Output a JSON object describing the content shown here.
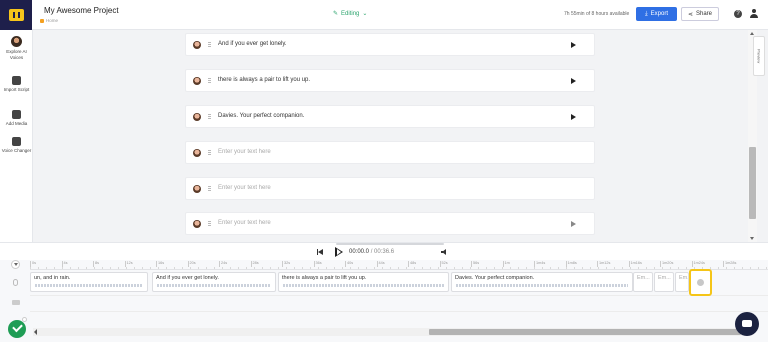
{
  "header": {
    "project_title": "My Awesome Project",
    "breadcrumb": "Home",
    "mode": "Editing",
    "time_remaining": "7h 55min of 8 hours available",
    "export_label": "Export",
    "share_label": "Share",
    "help_icon": "question-circle-icon",
    "user_icon": "user-icon"
  },
  "sidebar": {
    "items": [
      {
        "label": "Explore AI Voices",
        "icon": "voice-avatar-icon"
      },
      {
        "label": "Import Script",
        "icon": "import-icon"
      },
      {
        "label": "Add Media",
        "icon": "media-icon"
      },
      {
        "label": "Voice Changer",
        "icon": "voice-changer-icon"
      }
    ]
  },
  "script_rows": [
    {
      "text": "And if you ever get lonely.",
      "placeholder": false
    },
    {
      "text": "there is always a pair to lift you up.",
      "placeholder": false
    },
    {
      "text": "Davies. Your perfect companion.",
      "placeholder": false
    },
    {
      "text": "Enter your text here",
      "placeholder": true
    },
    {
      "text": "Enter your text here",
      "placeholder": true
    },
    {
      "text": "Enter your text here",
      "placeholder": true
    }
  ],
  "preview_tab": "Preview",
  "player": {
    "current_time": "00:00.0",
    "separator": " / ",
    "duration": "00:36.6"
  },
  "timeline": {
    "ticks": [
      "0s",
      "4s",
      "8s",
      "12s",
      "16s",
      "20s",
      "24s",
      "28s",
      "32s",
      "36s",
      "40s",
      "44s",
      "48s",
      "52s",
      "56s",
      "1m",
      "1m4s",
      "1m8s",
      "1m12s",
      "1m16s",
      "1m20s",
      "1m24s",
      "1m28s"
    ],
    "clips": [
      {
        "text": "un, and in rain.",
        "short": false
      },
      {
        "text": "And if you ever get lonely.",
        "short": false
      },
      {
        "text": "there is always a pair to lift you up.",
        "short": false
      },
      {
        "text": "Davies. Your perfect companion.",
        "short": false
      },
      {
        "text": "Em...",
        "short": true
      },
      {
        "text": "Em...",
        "short": true
      },
      {
        "text": "Em...",
        "short": true
      }
    ]
  },
  "colors": {
    "accent": "#2f6fe4",
    "editing": "#2ea56f",
    "highlight": "#f5c518",
    "logo_bg": "#1e1f4b"
  }
}
